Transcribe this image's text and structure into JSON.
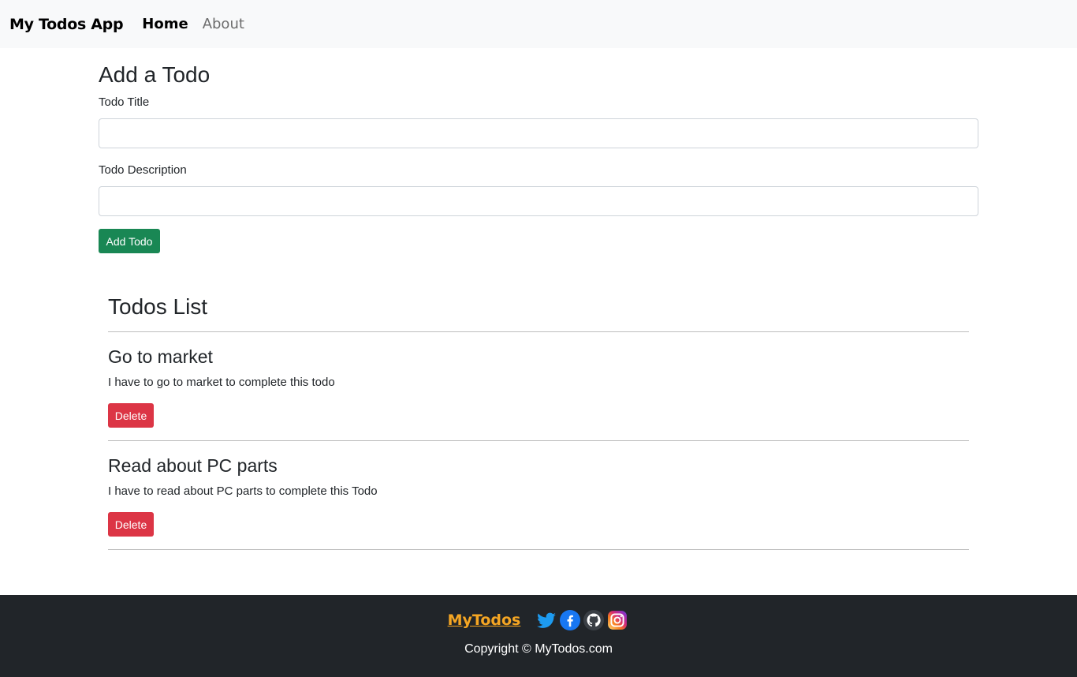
{
  "navbar": {
    "brand": "My Todos App",
    "links": [
      "Home",
      "About"
    ]
  },
  "form": {
    "heading": "Add a Todo",
    "title_label": "Todo Title",
    "title_value": "",
    "desc_label": "Todo Description",
    "desc_value": "",
    "submit_label": "Add Todo"
  },
  "todos": {
    "heading": "Todos List",
    "items": [
      {
        "title": "Go to market",
        "desc": "I have to go to market to complete this todo",
        "delete_label": "Delete"
      },
      {
        "title": "Read about PC parts",
        "desc": "I have to read about PC parts to complete this Todo",
        "delete_label": "Delete"
      }
    ]
  },
  "footer": {
    "brand": "MyTodos",
    "social_icons": [
      "twitter-icon",
      "facebook-icon",
      "github-icon",
      "instagram-icon"
    ],
    "copyright": "Copyright © MyTodos.com"
  },
  "colors": {
    "navbar_bg": "#f8f9fa",
    "success": "#198754",
    "danger": "#dc3545",
    "footer_bg": "#212529",
    "footer_brand": "#f5a623"
  }
}
